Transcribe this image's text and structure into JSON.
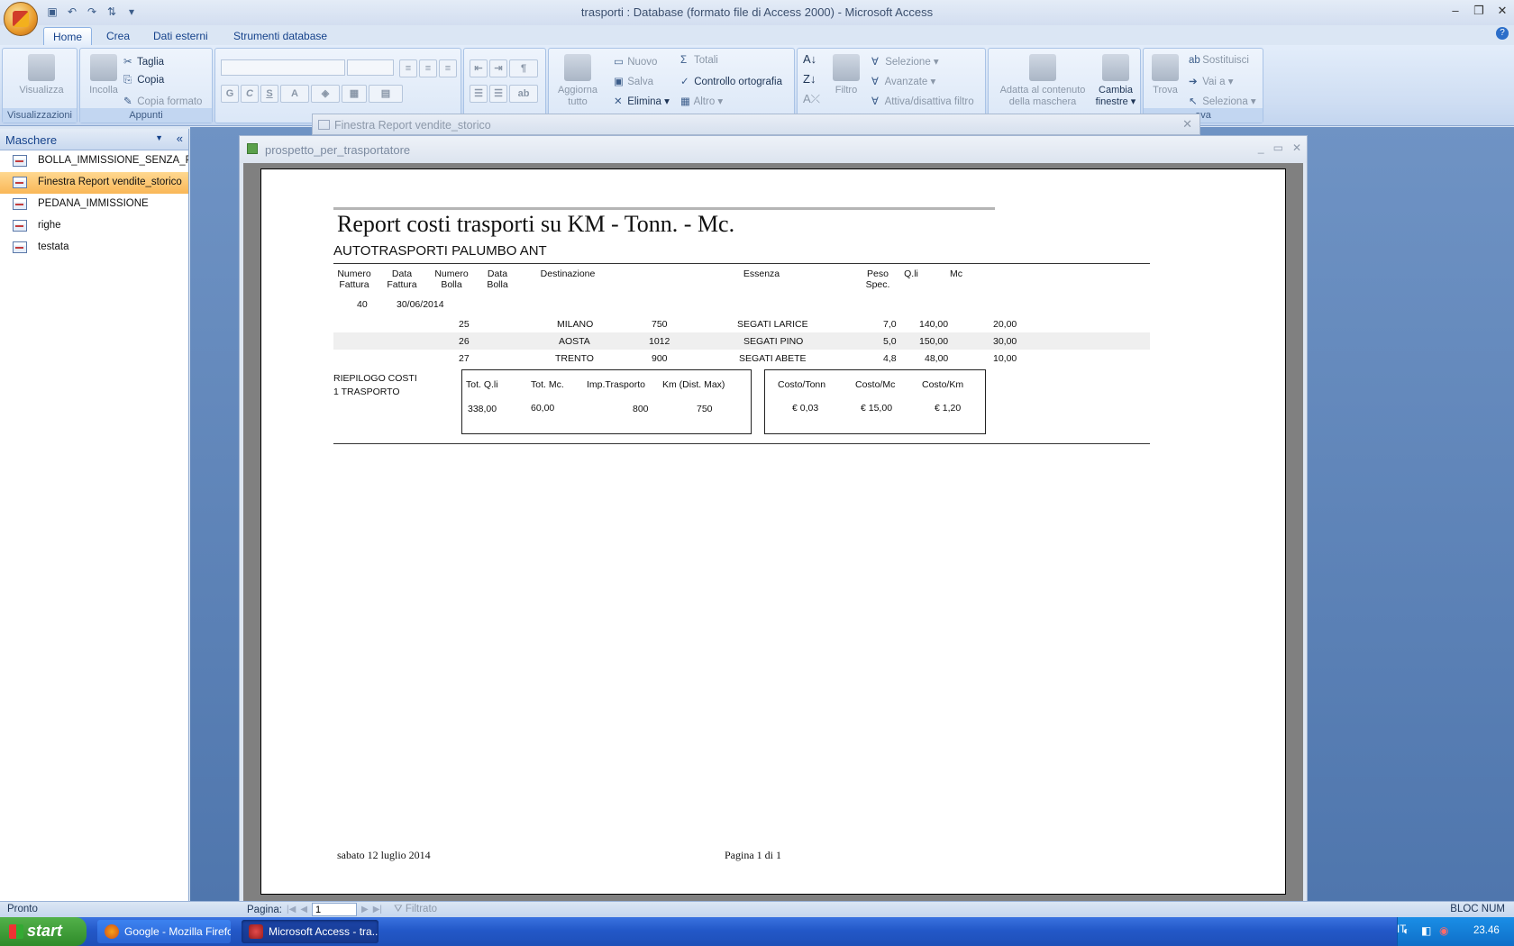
{
  "window": {
    "title": "trasporti : Database (formato file di Access 2000) - Microsoft Access"
  },
  "ribbon": {
    "tabs": [
      "Home",
      "Crea",
      "Dati esterni",
      "Strumenti database"
    ],
    "groups": {
      "visualizzazioni": {
        "label": "Visualizzazioni",
        "visualizza": "Visualizza"
      },
      "appunti": {
        "label": "Appunti",
        "incolla": "Incolla",
        "taglia": "Taglia",
        "copia": "Copia",
        "copia_formato": "Copia formato"
      },
      "record": {
        "aggiorna": "Aggiorna tutto",
        "nuovo": "Nuovo",
        "salva": "Salva",
        "elimina": "Elimina",
        "totali": "Totali",
        "controllo": "Controllo ortografia",
        "altro": "Altro"
      },
      "ordina": {
        "filtro": "Filtro",
        "selezione": "Selezione",
        "avanzate": "Avanzate",
        "attiva_filtro": "Attiva/disattiva filtro"
      },
      "finestra": {
        "adatta": "Adatta al contenuto della maschera",
        "cambia": "Cambia finestre"
      },
      "trova": {
        "label": "ova",
        "trova": "Trova",
        "sostituisci": "Sostituisci",
        "vai_a": "Vai a",
        "seleziona": "Seleziona"
      }
    }
  },
  "navpane": {
    "header": "Maschere",
    "items": [
      {
        "label": "BOLLA_IMMISSIONE_SENZA_P...",
        "selected": false
      },
      {
        "label": "Finestra Report vendite_storico",
        "selected": true
      },
      {
        "label": "PEDANA_IMMISSIONE",
        "selected": false
      },
      {
        "label": "righe",
        "selected": false
      },
      {
        "label": "testata",
        "selected": false
      }
    ]
  },
  "bg_window": {
    "title": "Finestra Report vendite_storico"
  },
  "report_window": {
    "title": "prospetto_per_trasportatore"
  },
  "report": {
    "title": "Report costi trasporti su KM - Tonn. - Mc.",
    "carrier": "AUTOTRASPORTI PALUMBO ANT",
    "headers": {
      "numero_fattura": "Numero Fattura",
      "data_fattura": "Data Fattura",
      "numero_bolla": "Numero Bolla",
      "data_bolla": "Data Bolla",
      "destinazione": "Destinazione",
      "essenza": "Essenza",
      "peso_spec": "Peso Spec.",
      "qli": "Q.li",
      "mc": "Mc"
    },
    "invoice": {
      "numero": "40",
      "data": "30/06/2014"
    },
    "rows": [
      {
        "bolla": "25",
        "destinazione": "MILANO",
        "km": "750",
        "essenza": "SEGATI LARICE",
        "peso": "7,0",
        "qli": "140,00",
        "mc": "20,00"
      },
      {
        "bolla": "26",
        "destinazione": "AOSTA",
        "km": "1012",
        "essenza": "SEGATI PINO",
        "peso": "5,0",
        "qli": "150,00",
        "mc": "30,00"
      },
      {
        "bolla": "27",
        "destinazione": "TRENTO",
        "km": "900",
        "essenza": "SEGATI ABETE",
        "peso": "4,8",
        "qli": "48,00",
        "mc": "10,00"
      }
    ],
    "summary": {
      "label1": "RIEPILOGO COSTI",
      "label2": "1  TRASPORTO",
      "tot_qli_h": "Tot. Q.li",
      "tot_qli": "338,00",
      "tot_mc_h": "Tot. Mc.",
      "tot_mc": "60,00",
      "imp_h": "Imp.Trasporto",
      "imp": "800",
      "km_h": "Km (Dist. Max)",
      "km": "750",
      "costo_tonn_h": "Costo/Tonn",
      "costo_tonn": "€ 0,03",
      "costo_mc_h": "Costo/Mc",
      "costo_mc": "€ 15,00",
      "costo_km_h": "Costo/Km",
      "costo_km": "€ 1,20"
    },
    "footer": {
      "date": "sabato 12 luglio 2014",
      "page": "Pagina 1 di 1"
    }
  },
  "statusbar": {
    "left": "Pronto",
    "pager_label": "Pagina:",
    "page_value": "1",
    "filter": "Filtrato",
    "right": "BLOC NUM"
  },
  "taskbar": {
    "start": "start",
    "tasks": [
      "Google - Mozilla Firefox",
      "Microsoft Access - tra..."
    ],
    "lang": "IT",
    "clock": "23.46"
  }
}
